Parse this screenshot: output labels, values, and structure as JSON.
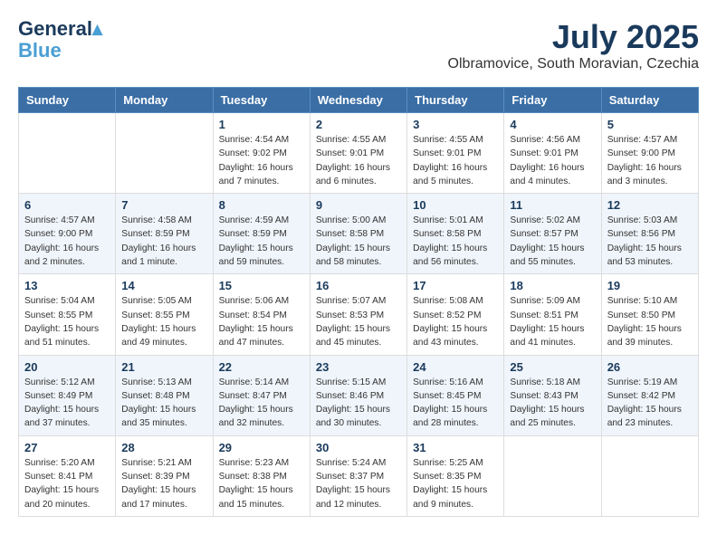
{
  "header": {
    "logo_line1": "General",
    "logo_line2": "Blue",
    "month_year": "July 2025",
    "location": "Olbramovice, South Moravian, Czechia"
  },
  "weekdays": [
    "Sunday",
    "Monday",
    "Tuesday",
    "Wednesday",
    "Thursday",
    "Friday",
    "Saturday"
  ],
  "weeks": [
    [
      {
        "day": "",
        "info": ""
      },
      {
        "day": "",
        "info": ""
      },
      {
        "day": "1",
        "info": "Sunrise: 4:54 AM\nSunset: 9:02 PM\nDaylight: 16 hours and 7 minutes."
      },
      {
        "day": "2",
        "info": "Sunrise: 4:55 AM\nSunset: 9:01 PM\nDaylight: 16 hours and 6 minutes."
      },
      {
        "day": "3",
        "info": "Sunrise: 4:55 AM\nSunset: 9:01 PM\nDaylight: 16 hours and 5 minutes."
      },
      {
        "day": "4",
        "info": "Sunrise: 4:56 AM\nSunset: 9:01 PM\nDaylight: 16 hours and 4 minutes."
      },
      {
        "day": "5",
        "info": "Sunrise: 4:57 AM\nSunset: 9:00 PM\nDaylight: 16 hours and 3 minutes."
      }
    ],
    [
      {
        "day": "6",
        "info": "Sunrise: 4:57 AM\nSunset: 9:00 PM\nDaylight: 16 hours and 2 minutes."
      },
      {
        "day": "7",
        "info": "Sunrise: 4:58 AM\nSunset: 8:59 PM\nDaylight: 16 hours and 1 minute."
      },
      {
        "day": "8",
        "info": "Sunrise: 4:59 AM\nSunset: 8:59 PM\nDaylight: 15 hours and 59 minutes."
      },
      {
        "day": "9",
        "info": "Sunrise: 5:00 AM\nSunset: 8:58 PM\nDaylight: 15 hours and 58 minutes."
      },
      {
        "day": "10",
        "info": "Sunrise: 5:01 AM\nSunset: 8:58 PM\nDaylight: 15 hours and 56 minutes."
      },
      {
        "day": "11",
        "info": "Sunrise: 5:02 AM\nSunset: 8:57 PM\nDaylight: 15 hours and 55 minutes."
      },
      {
        "day": "12",
        "info": "Sunrise: 5:03 AM\nSunset: 8:56 PM\nDaylight: 15 hours and 53 minutes."
      }
    ],
    [
      {
        "day": "13",
        "info": "Sunrise: 5:04 AM\nSunset: 8:55 PM\nDaylight: 15 hours and 51 minutes."
      },
      {
        "day": "14",
        "info": "Sunrise: 5:05 AM\nSunset: 8:55 PM\nDaylight: 15 hours and 49 minutes."
      },
      {
        "day": "15",
        "info": "Sunrise: 5:06 AM\nSunset: 8:54 PM\nDaylight: 15 hours and 47 minutes."
      },
      {
        "day": "16",
        "info": "Sunrise: 5:07 AM\nSunset: 8:53 PM\nDaylight: 15 hours and 45 minutes."
      },
      {
        "day": "17",
        "info": "Sunrise: 5:08 AM\nSunset: 8:52 PM\nDaylight: 15 hours and 43 minutes."
      },
      {
        "day": "18",
        "info": "Sunrise: 5:09 AM\nSunset: 8:51 PM\nDaylight: 15 hours and 41 minutes."
      },
      {
        "day": "19",
        "info": "Sunrise: 5:10 AM\nSunset: 8:50 PM\nDaylight: 15 hours and 39 minutes."
      }
    ],
    [
      {
        "day": "20",
        "info": "Sunrise: 5:12 AM\nSunset: 8:49 PM\nDaylight: 15 hours and 37 minutes."
      },
      {
        "day": "21",
        "info": "Sunrise: 5:13 AM\nSunset: 8:48 PM\nDaylight: 15 hours and 35 minutes."
      },
      {
        "day": "22",
        "info": "Sunrise: 5:14 AM\nSunset: 8:47 PM\nDaylight: 15 hours and 32 minutes."
      },
      {
        "day": "23",
        "info": "Sunrise: 5:15 AM\nSunset: 8:46 PM\nDaylight: 15 hours and 30 minutes."
      },
      {
        "day": "24",
        "info": "Sunrise: 5:16 AM\nSunset: 8:45 PM\nDaylight: 15 hours and 28 minutes."
      },
      {
        "day": "25",
        "info": "Sunrise: 5:18 AM\nSunset: 8:43 PM\nDaylight: 15 hours and 25 minutes."
      },
      {
        "day": "26",
        "info": "Sunrise: 5:19 AM\nSunset: 8:42 PM\nDaylight: 15 hours and 23 minutes."
      }
    ],
    [
      {
        "day": "27",
        "info": "Sunrise: 5:20 AM\nSunset: 8:41 PM\nDaylight: 15 hours and 20 minutes."
      },
      {
        "day": "28",
        "info": "Sunrise: 5:21 AM\nSunset: 8:39 PM\nDaylight: 15 hours and 17 minutes."
      },
      {
        "day": "29",
        "info": "Sunrise: 5:23 AM\nSunset: 8:38 PM\nDaylight: 15 hours and 15 minutes."
      },
      {
        "day": "30",
        "info": "Sunrise: 5:24 AM\nSunset: 8:37 PM\nDaylight: 15 hours and 12 minutes."
      },
      {
        "day": "31",
        "info": "Sunrise: 5:25 AM\nSunset: 8:35 PM\nDaylight: 15 hours and 9 minutes."
      },
      {
        "day": "",
        "info": ""
      },
      {
        "day": "",
        "info": ""
      }
    ]
  ]
}
